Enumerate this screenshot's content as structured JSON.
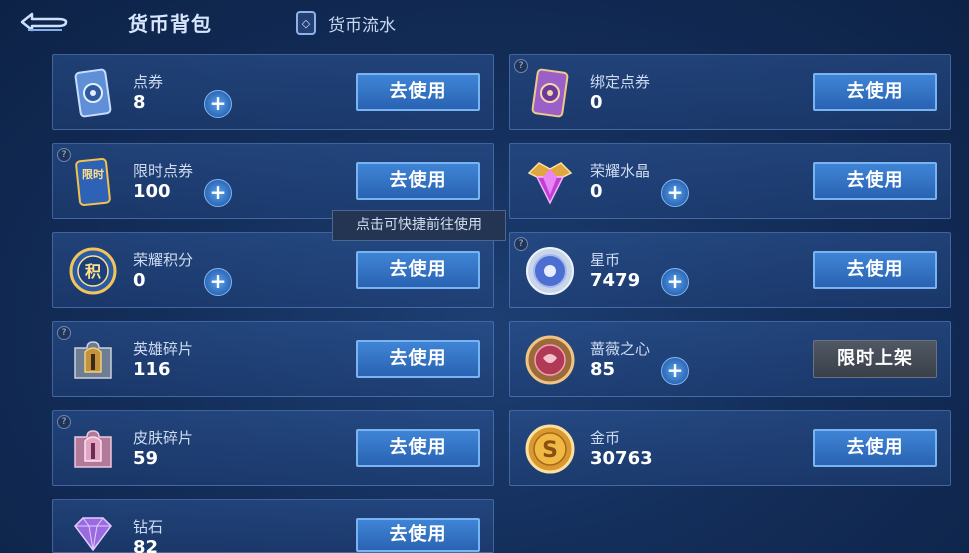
{
  "header": {
    "title": "货币背包",
    "flow_label": "货币流水"
  },
  "tooltip": "点击可快捷前往使用",
  "currencies": [
    {
      "name": "点券",
      "value": "8",
      "button": "去使用",
      "icon": "coupon-icon"
    },
    {
      "name": "绑定点券",
      "value": "0",
      "button": "去使用",
      "icon": "bound-coupon-icon"
    },
    {
      "name": "限时点券",
      "value": "100",
      "button": "去使用",
      "icon": "limited-coupon-icon",
      "icon_text": "限时"
    },
    {
      "name": "荣耀水晶",
      "value": "0",
      "button": "去使用",
      "icon": "glory-crystal-icon"
    },
    {
      "name": "荣耀积分",
      "value": "0",
      "button": "去使用",
      "icon": "glory-points-icon",
      "icon_text": "积"
    },
    {
      "name": "星币",
      "value": "7479",
      "button": "去使用",
      "icon": "star-coin-icon"
    },
    {
      "name": "英雄碎片",
      "value": "116",
      "button": "去使用",
      "icon": "hero-fragment-icon"
    },
    {
      "name": "蔷薇之心",
      "value": "85",
      "button": "限时上架",
      "icon": "rose-heart-icon"
    },
    {
      "name": "皮肤碎片",
      "value": "59",
      "button": "去使用",
      "icon": "skin-fragment-icon"
    },
    {
      "name": "金币",
      "value": "30763",
      "button": "去使用",
      "icon": "gold-coin-icon",
      "icon_text": "S"
    },
    {
      "name": "钻石",
      "value": "82",
      "button": "去使用",
      "icon": "diamond-icon"
    }
  ],
  "colors": {
    "accent": "#3f84d6",
    "background": "#142f5c",
    "panel": "#2e5696"
  }
}
